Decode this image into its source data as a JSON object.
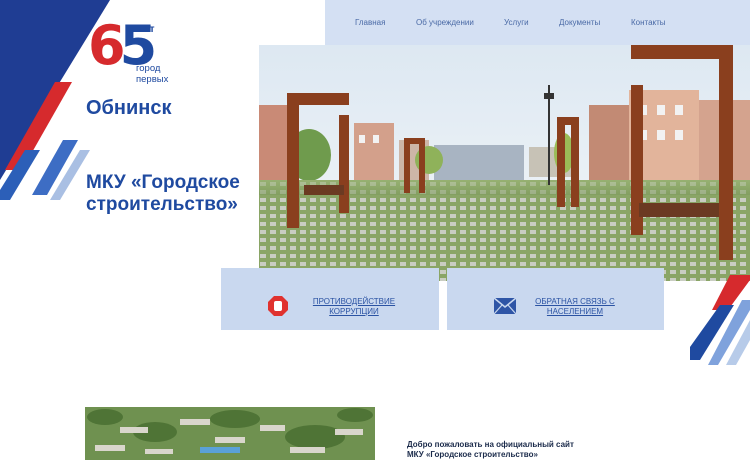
{
  "logo": {
    "number_six": "6",
    "number_five": "5",
    "years": "лет",
    "slogan_line1": "город",
    "slogan_line2": "первых"
  },
  "header": {
    "city": "Обнинск",
    "organization": "МКУ «Городское строительство»"
  },
  "nav": {
    "items": [
      "Главная",
      "Об учреждении",
      "Услуги",
      "Документы",
      "Контакты"
    ]
  },
  "cards": {
    "anticorruption": {
      "label_line1": "ПРОТИВОДЕЙСТВИЕ",
      "label_line2": "КОРРУПЦИИ",
      "icon": "stop-hand-icon"
    },
    "feedback": {
      "label_line1": "ОБРАТНАЯ СВЯЗЬ С",
      "label_line2": "НАСЕЛЕНИЕМ",
      "icon": "envelope-icon"
    }
  },
  "welcome": {
    "line1": "Добро пожаловать на официальный сайт",
    "line2": "МКУ «Городское строительство»"
  },
  "colors": {
    "brand_blue": "#1f4aa0",
    "brand_red": "#d62a2d",
    "nav_bg": "#d4e0f3",
    "card_bg": "#c9d8ef"
  }
}
